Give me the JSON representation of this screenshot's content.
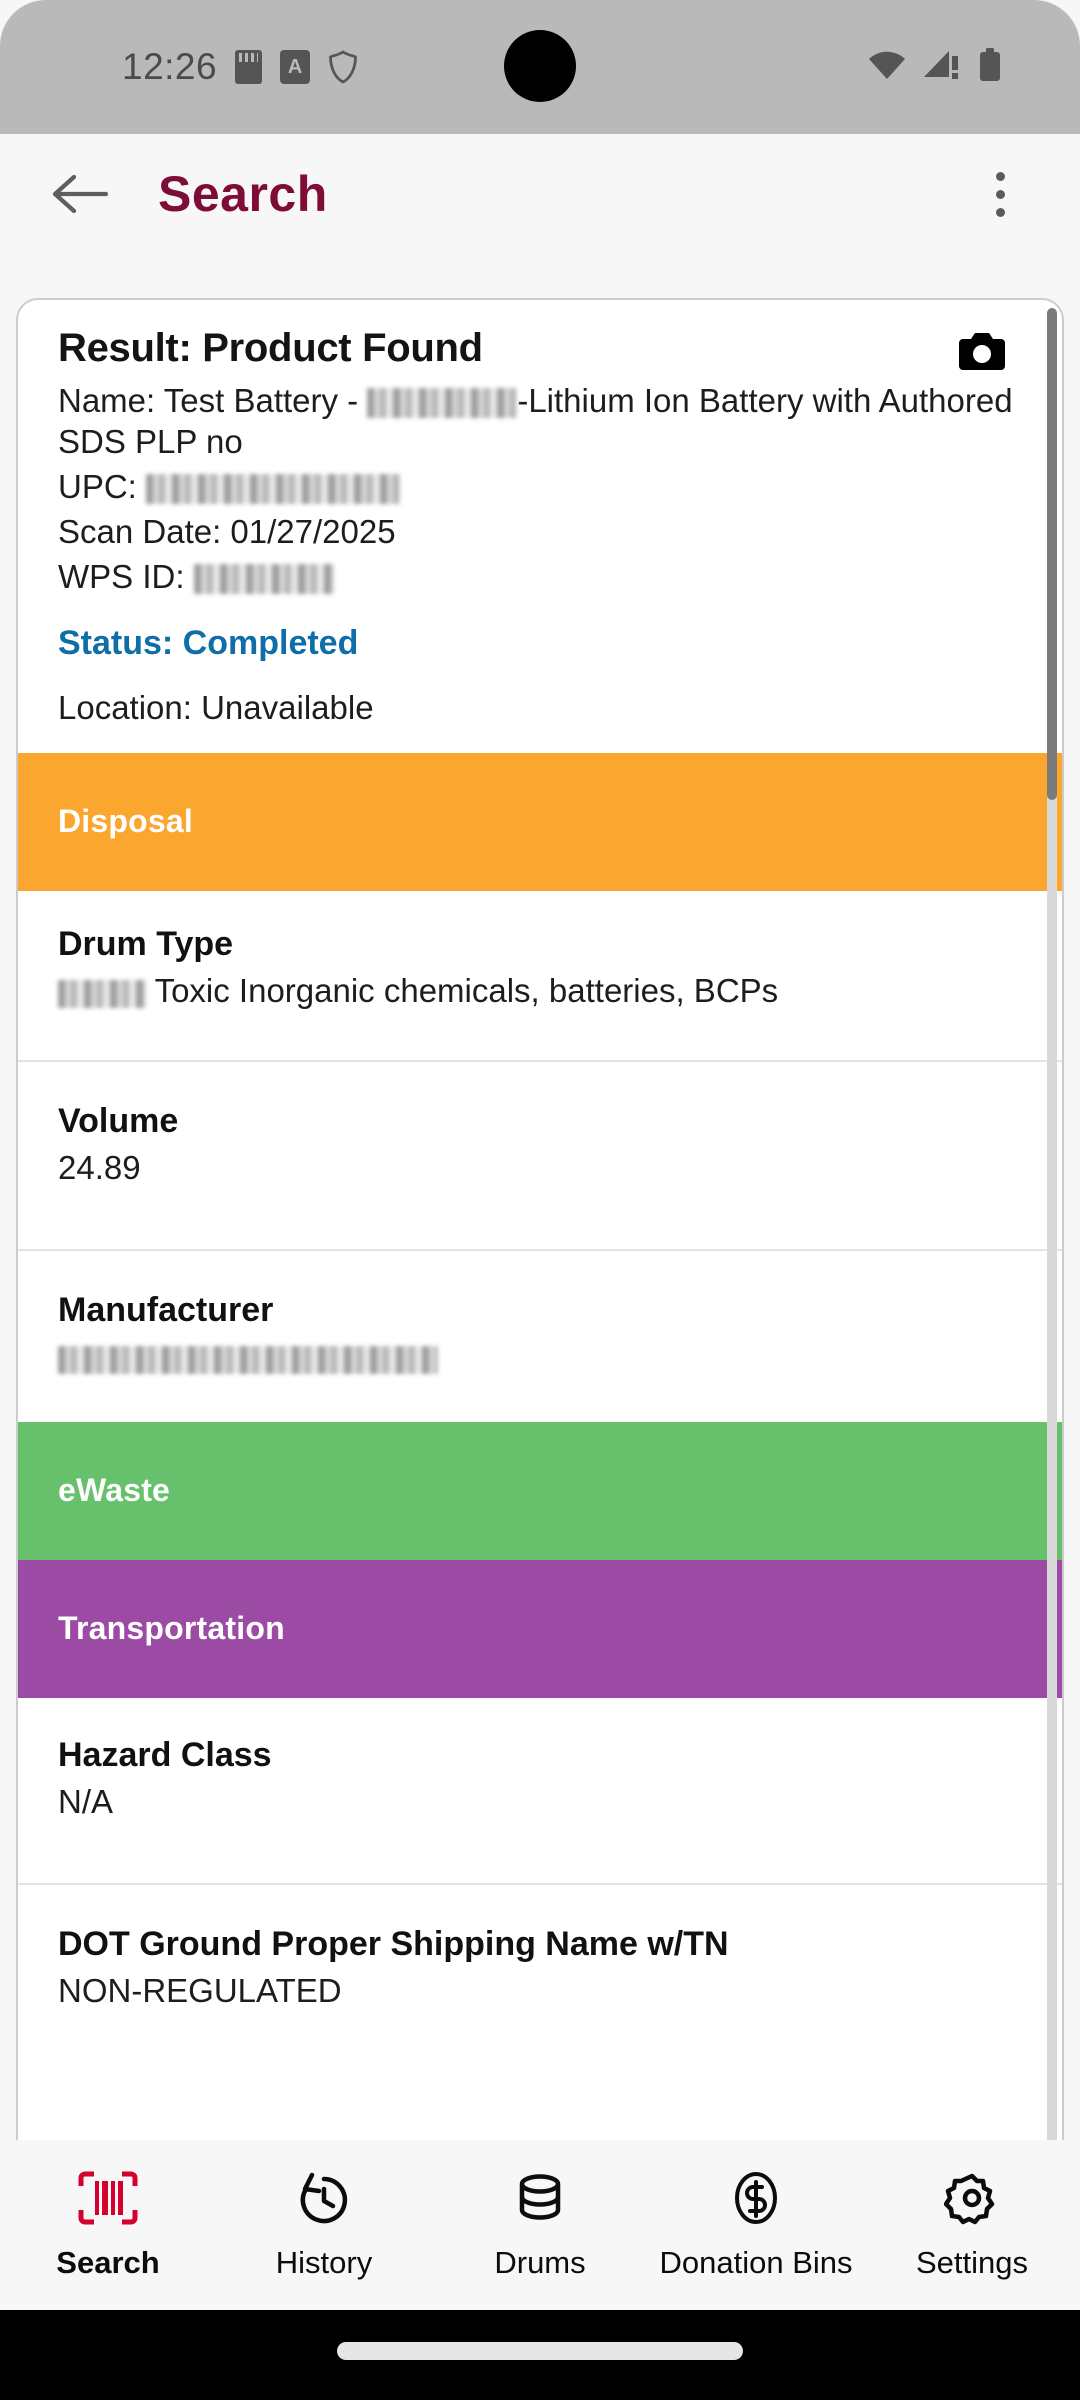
{
  "status_bar": {
    "time": "12:26",
    "icons_left": [
      "sd-card-icon",
      "a-badge-icon",
      "shield-icon"
    ],
    "icons_right": [
      "wifi-icon",
      "cellular-signal-warning-icon",
      "battery-icon"
    ]
  },
  "app_bar": {
    "back_label": "back-arrow",
    "title": "Search",
    "overflow_label": "more-options",
    "title_color": "#7d0d36"
  },
  "card": {
    "result_title": "Result: Product Found",
    "camera_icon": "camera-icon",
    "name_prefix": "Name: Test Battery - ",
    "name_redacted": "",
    "name_suffix": "-Lithium Ion Battery with Authored SDS PLP no",
    "upc_label": "UPC: ",
    "upc_redacted": "",
    "scan_date": "Scan Date: 01/27/2025",
    "wps_label": "WPS ID: ",
    "wps_redacted": "",
    "status": "Status: Completed",
    "status_color": "#0f6ea8",
    "location": "Location: Unavailable"
  },
  "sections": [
    {
      "band_label": "Disposal",
      "band_color": "#fba62e",
      "fields": [
        {
          "title": "Drum Type",
          "value_redacted": "",
          "value": " Toxic Inorganic chemicals, batteries, BCPs"
        },
        {
          "title": "Volume",
          "value": "24.89"
        },
        {
          "title": "Manufacturer",
          "value_redacted": "",
          "value": ""
        }
      ]
    },
    {
      "band_label": "eWaste",
      "band_color": "#66c06c",
      "fields": []
    },
    {
      "band_label": "Transportation",
      "band_color": "#9b4ba3",
      "fields": [
        {
          "title": "Hazard Class",
          "value": "N/A"
        },
        {
          "title": "DOT Ground Proper Shipping Name w/TN",
          "value": "NON-REGULATED"
        }
      ]
    }
  ],
  "bottom_nav": {
    "active_index": 0,
    "active_color": "#d6002e",
    "items": [
      {
        "label": "Search",
        "icon": "barcode-scan-icon"
      },
      {
        "label": "History",
        "icon": "history-clock-icon"
      },
      {
        "label": "Drums",
        "icon": "database-drum-icon"
      },
      {
        "label": "Donation Bins",
        "icon": "dollar-circle-icon"
      },
      {
        "label": "Settings",
        "icon": "gear-icon"
      }
    ]
  }
}
